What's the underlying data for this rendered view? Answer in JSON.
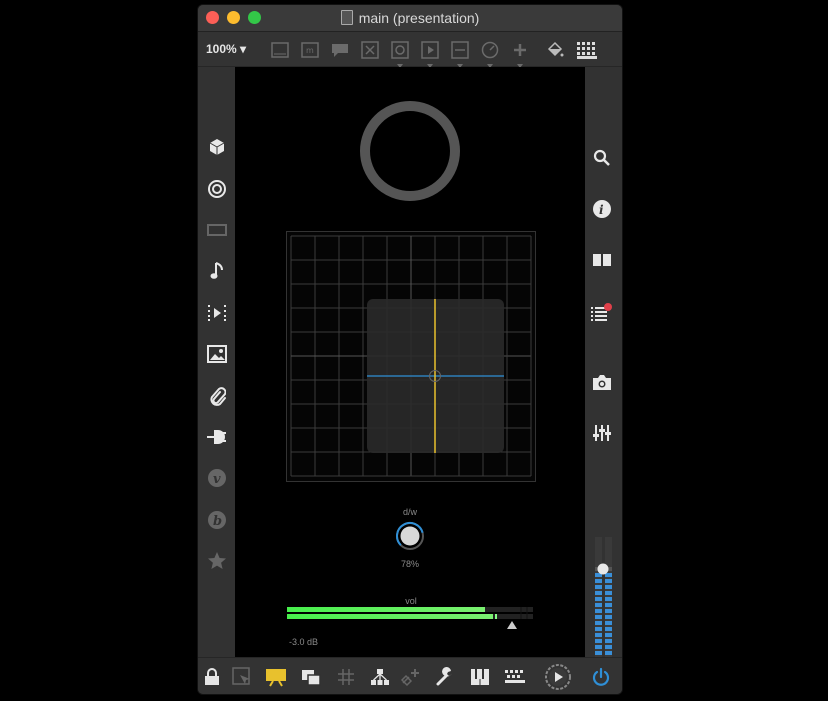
{
  "window": {
    "title": "main (presentation)"
  },
  "toolbar": {
    "zoom": "100% ▾"
  },
  "drywet": {
    "label": "d/w",
    "value": "78%",
    "level": 0.78
  },
  "volume": {
    "label": "vol",
    "value": "-3.0 dB"
  },
  "colors": {
    "accent_yellow": "#e8c12d",
    "accent_blue": "#2f8fd6",
    "meter_green": "#3de04a",
    "ring_gray": "#555555"
  },
  "icons": {
    "left": [
      "cube-icon",
      "target-icon",
      "display-icon",
      "music-note-icon",
      "play-frames-icon",
      "image-icon",
      "paperclip-icon",
      "plug-icon",
      "v-circle-icon",
      "b-circle-icon",
      "star-icon"
    ],
    "right": [
      "search-icon",
      "info-icon",
      "book-icon",
      "list-notification-icon",
      "camera-icon",
      "mixer-sliders-icon"
    ],
    "bottom": [
      "lock-icon",
      "edit-mode-icon",
      "presentation-icon",
      "window-stack-icon",
      "grid-icon",
      "hierarchy-icon",
      "add-link-icon",
      "wrench-icon",
      "piano-icon",
      "keyboard-icon",
      "play-icon",
      "power-icon"
    ]
  }
}
